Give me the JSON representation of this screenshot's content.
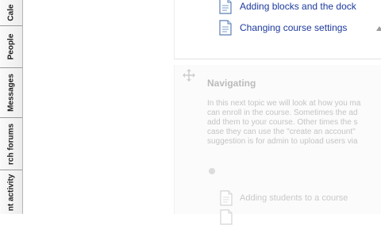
{
  "dock": {
    "tabs": [
      {
        "label": "Cale",
        "icon": "calendar-tab"
      },
      {
        "label": "People",
        "icon": "people-tab"
      },
      {
        "label": "Messages",
        "icon": "messages-tab"
      },
      {
        "label": "rch forums",
        "icon": "search-forums-tab"
      },
      {
        "label": "nt activity",
        "icon": "recent-activity-tab"
      }
    ]
  },
  "top_section": {
    "activities": [
      {
        "label": "Adding blocks and the dock",
        "icon": "document-icon"
      },
      {
        "label": "Changing course settings",
        "icon": "document-icon"
      }
    ],
    "collapse_icon": "chevron-up-icon"
  },
  "section_navigating": {
    "title": "Navigating",
    "move_icon": "move-icon",
    "summary_lines": [
      "In this next topic we will look at how you ma",
      "can enroll in the course. Sometimes the ad",
      "add them to your course. Other times the s",
      "case they can use the \"create an account\"",
      "suggestion is for admin to upload users via"
    ],
    "activities": [
      {
        "label": "Adding students to a course",
        "icon": "document-icon"
      },
      {
        "label": "",
        "icon": "document-icon"
      }
    ]
  },
  "colors": {
    "link": "#1d3a9c",
    "faded_text": "#c4c4c4",
    "dock_border": "#9a9a9a"
  }
}
